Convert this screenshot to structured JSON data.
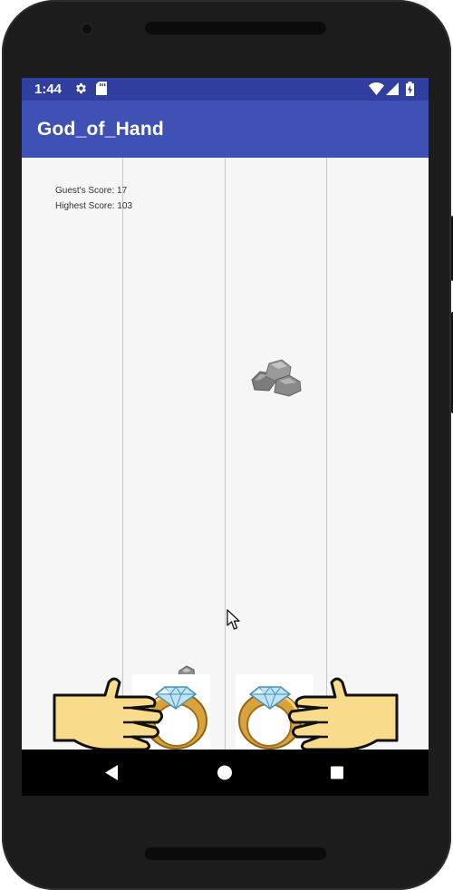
{
  "status_bar": {
    "time": "1:44",
    "icons": [
      "gear-icon",
      "sd-card-icon",
      "wifi-icon",
      "signal-icon",
      "battery-icon"
    ]
  },
  "app_bar": {
    "title": "God_of_Hand"
  },
  "game": {
    "guest_score_label": "Guest's Score: 17",
    "highest_score_label": "Highest Score: 103",
    "lane_count": 4,
    "falling_objects": [
      "rock"
    ],
    "player_items": [
      "left-ring",
      "right-ring"
    ],
    "colors": {
      "status_bar": "#303f9f",
      "app_bar": "#3f51b5",
      "background": "#f6f6f6",
      "lane_line": "#c8c8c8",
      "hand_fill": "#f8dc8c",
      "ring_gold": "#c9962a",
      "diamond": "#bfe4f5",
      "rock": "#8a8a8a"
    }
  },
  "nav_bar": {
    "buttons": [
      "back-icon",
      "home-icon",
      "recents-icon"
    ]
  }
}
